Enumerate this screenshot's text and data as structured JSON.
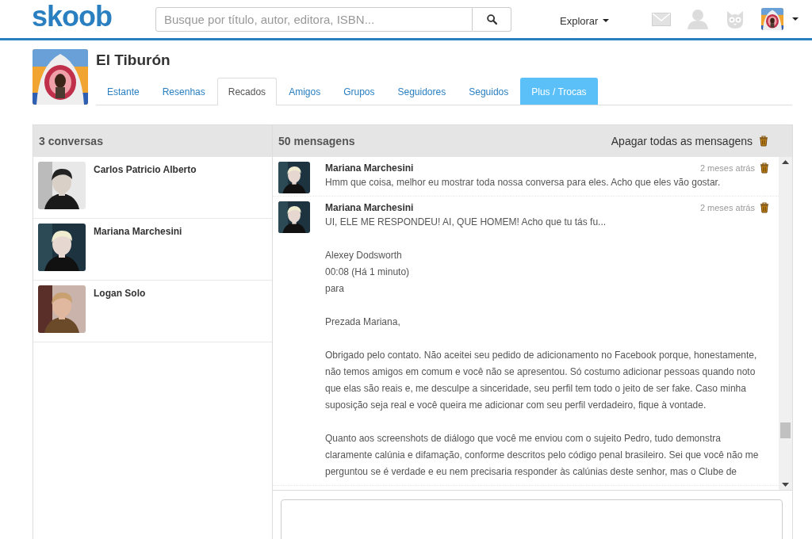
{
  "header": {
    "logo": "skoob",
    "search": {
      "placeholder": "Busque por título, autor, editora, ISBN..."
    },
    "explore": "Explorar"
  },
  "profile": {
    "name": "El Tiburón",
    "tabs": [
      {
        "label": "Estante",
        "selected": false,
        "kind": "tab"
      },
      {
        "label": "Resenhas",
        "selected": false,
        "kind": "tab"
      },
      {
        "label": "Recados",
        "selected": true,
        "kind": "tab"
      },
      {
        "label": "Amigos",
        "selected": false,
        "kind": "tab"
      },
      {
        "label": "Grupos",
        "selected": false,
        "kind": "tab"
      },
      {
        "label": "Seguidores",
        "selected": false,
        "kind": "tab"
      },
      {
        "label": "Seguidos",
        "selected": false,
        "kind": "tab"
      },
      {
        "label": "Plus / Trocas",
        "selected": false,
        "kind": "plus"
      }
    ]
  },
  "conversations": {
    "title": "3 conversas",
    "items": [
      {
        "name": "Carlos Patricio Alberto",
        "selected": false
      },
      {
        "name": "Mariana Marchesini",
        "selected": false
      },
      {
        "name": "Logan Solo",
        "selected": false
      }
    ]
  },
  "messages": {
    "title": "50 mensagens",
    "delete_all": "Apagar todas as mensagens",
    "items": [
      {
        "author": "Mariana Marchesini",
        "time": "2 meses atrás",
        "paragraphs": [
          [
            "Hmm que coisa, melhor eu mostrar toda nossa conversa para eles. Acho que eles vão gostar."
          ]
        ]
      },
      {
        "author": "Mariana Marchesini",
        "time": "2 meses atrás",
        "paragraphs": [
          [
            "UI, ELE ME RESPONDEU! AI, QUE HOMEM! Acho que tu tás fu..."
          ],
          [
            "Alexey Dodsworth",
            "00:08 (Há 1 minuto)",
            "para"
          ],
          [
            "Prezada Mariana,"
          ],
          [
            "Obrigado pelo contato. Não aceitei seu pedido de adicionamento no Facebook porque, honestamente, não temos amigos em comum e você não se apresentou. Só costumo adicionar pessoas quando noto que elas são reais e, me desculpe a sinceridade, seu perfil tem todo o jeito de ser fake. Caso minha suposição seja real e você queira me adicionar com seu perfil verdadeiro, fique à vontade."
          ],
          [
            "Quanto aos screenshots de diálogo que você me enviou com o sujeito Pedro, tudo demonstra claramente calúnia e difamação, conforme descritos pelo código penal brasileiro. Sei que você não me perguntou se é verdade e eu nem precisaria responder às calúnias deste senhor, mas o Clube de"
          ]
        ]
      }
    ]
  }
}
